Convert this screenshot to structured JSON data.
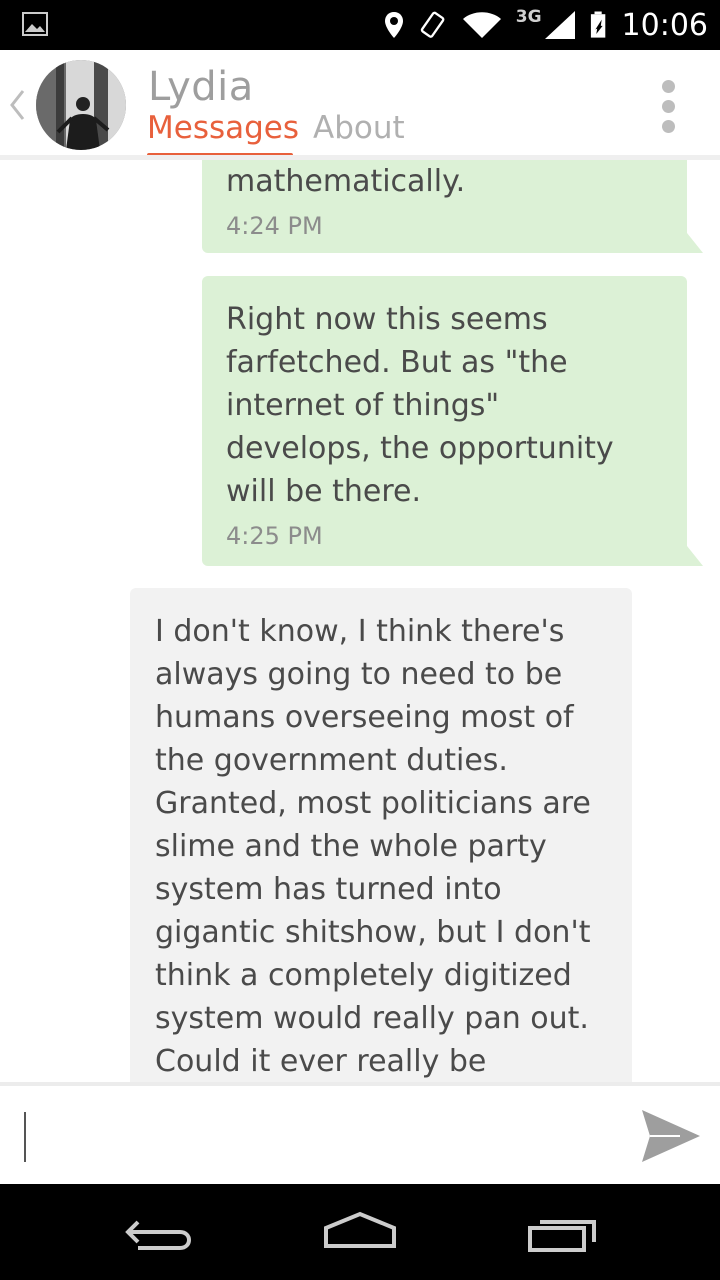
{
  "status_bar": {
    "network": "3G",
    "time": "10:06",
    "icons": [
      "gallery-icon",
      "location-icon",
      "rotate-icon",
      "wifi-icon",
      "signal-icon",
      "battery-icon"
    ]
  },
  "header": {
    "contact_name": "Lydia",
    "tabs": [
      {
        "label": "Messages",
        "active": true
      },
      {
        "label": "About",
        "active": false
      }
    ],
    "accent_color": "#e8603c"
  },
  "messages": [
    {
      "direction": "outgoing",
      "text": "mathematically.",
      "time": "4:24 PM"
    },
    {
      "direction": "outgoing",
      "text": "Right now this seems\nfarfetched. But as \"the\ninternet of things\"\ndevelops, the opportunity\nwill be there.",
      "time": "4:25 PM"
    },
    {
      "direction": "incoming",
      "text": "I don't know, I think there's\nalways going to need to be\nhumans overseeing most of\nthe government duties.\nGranted, most politicians are\nslime and the whole party\nsystem has turned into\ngigantic shitshow, but I don't\nthink a completely digitized\nsystem would really pan out.\nCould it ever really be",
      "time": ""
    }
  ],
  "composer": {
    "value": "",
    "placeholder": ""
  },
  "colors": {
    "outgoing_bubble": "#dcf1d6",
    "incoming_bubble": "#f2f2f2"
  }
}
